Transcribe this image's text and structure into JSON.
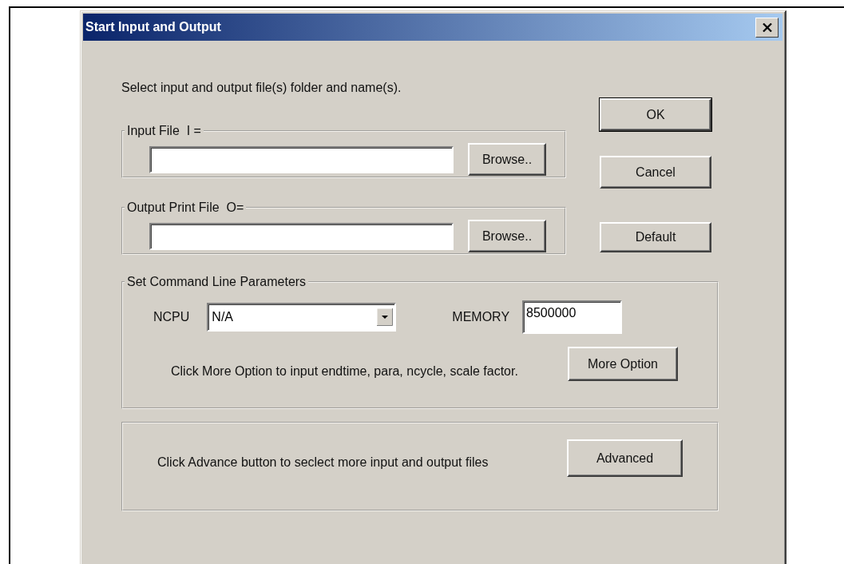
{
  "window": {
    "title": "Start Input and Output"
  },
  "instruction": "Select input and output file(s) folder and name(s).",
  "file_groups": [
    {
      "label": "Input File  I =",
      "button": "Browse.."
    },
    {
      "label": "Output Print File  O=",
      "button": "Browse.."
    }
  ],
  "buttons": [
    {
      "label": "OK",
      "default": true
    },
    {
      "label": "Cancel",
      "default": false
    },
    {
      "label": "Default",
      "default": false
    }
  ],
  "parameters": {
    "label": "Set Command Line Parameters",
    "ncpu": {
      "label": "NCPU",
      "value": "N/A"
    },
    "memory": {
      "label": "MEMORY",
      "value": "8500000"
    },
    "note": "Click More Option to input endtime, para, ncycle, scale factor.",
    "button": "More Option"
  },
  "advanced": {
    "note": "Click Advance button to seclect more input and output files",
    "button": "Advanced"
  }
}
